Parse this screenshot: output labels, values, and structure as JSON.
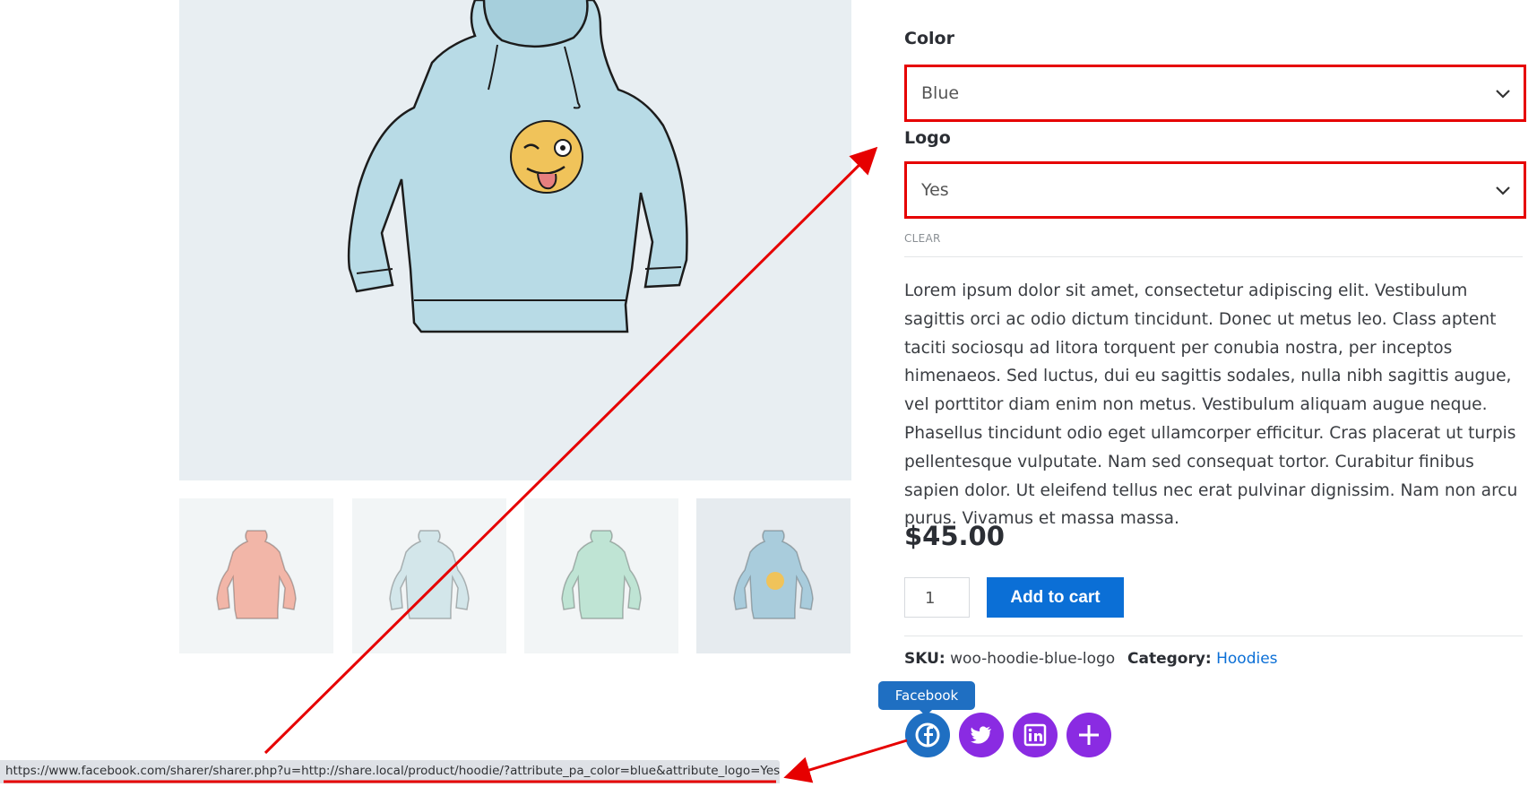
{
  "product": {
    "attributes": [
      {
        "label": "Color",
        "value": "Blue"
      },
      {
        "label": "Logo",
        "value": "Yes"
      }
    ],
    "clear_label": "CLEAR",
    "description": "Lorem ipsum dolor sit amet, consectetur adipiscing elit. Vestibulum sagittis orci ac odio dictum tincidunt. Donec ut metus leo. Class aptent taciti sociosqu ad litora torquent per conubia nostra, per inceptos himenaeos. Sed luctus, dui eu sagittis sodales, nulla nibh sagittis augue, vel porttitor diam enim non metus. Vestibulum aliquam augue neque. Phasellus tincidunt odio eget ullamcorper efficitur. Cras placerat ut turpis pellentesque vulputate. Nam sed consequat tortor. Curabitur finibus sapien dolor. Ut eleifend tellus nec erat pulvinar dignissim. Nam non arcu purus. Vivamus et massa massa.",
    "price": "$45.00",
    "quantity": "1",
    "add_to_cart_label": "Add to cart",
    "sku_label": "SKU:",
    "sku_value": "woo-hoodie-blue-logo",
    "category_label": "Category:",
    "category_value": "Hoodies"
  },
  "gallery": {
    "thumbnails": [
      {
        "color": "#f2b6a8",
        "icon": "hoodie-pink-icon"
      },
      {
        "color": "#d3e6ea",
        "icon": "hoodie-light-blue-icon"
      },
      {
        "color": "#bfe4d4",
        "icon": "hoodie-green-icon"
      },
      {
        "color": "#a9ccdc",
        "icon": "hoodie-blue-logo-icon"
      }
    ]
  },
  "share": {
    "tooltip": "Facebook",
    "buttons": [
      {
        "icon": "facebook-icon",
        "color": "#1f6fc2"
      },
      {
        "icon": "twitter-icon",
        "color": "#8a2be2"
      },
      {
        "icon": "linkedin-icon",
        "color": "#8a2be2"
      },
      {
        "icon": "plus-icon",
        "color": "#8a2be2"
      }
    ]
  },
  "status_bar": {
    "url": "https://www.facebook.com/sharer/sharer.php?u=http://share.local/product/hoodie/?attribute_pa_color=blue&attribute_logo=Yes"
  },
  "annotation_color": "#e60000"
}
